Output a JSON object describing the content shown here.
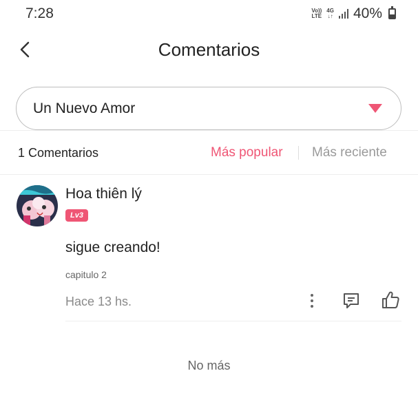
{
  "status_bar": {
    "time": "7:28",
    "volte_label": "Vo)) LTE",
    "network_label": "4G",
    "battery_percent": "40%",
    "battery_level": 0.4
  },
  "header": {
    "title": "Comentarios",
    "back_icon": "chevron-left-icon"
  },
  "selector": {
    "value": "Un Nuevo Amor",
    "caret_icon": "triangle-down-icon",
    "caret_color": "#ef5675"
  },
  "comments_bar": {
    "count_label": "1 Comentarios",
    "sort_popular": "Más popular",
    "sort_recent": "Más reciente",
    "active_sort": "Más popular",
    "active_color": "#ef5675"
  },
  "comments": [
    {
      "username": "Hoa thiên lý",
      "level": "Lv3",
      "text": "sigue creando!",
      "chapter": "capitulo 2",
      "time_ago": "Hace 13 hs.",
      "actions": [
        "more-vertical-icon",
        "reply-icon",
        "thumbs-up-icon"
      ]
    }
  ],
  "footer": {
    "no_more": "No más"
  }
}
